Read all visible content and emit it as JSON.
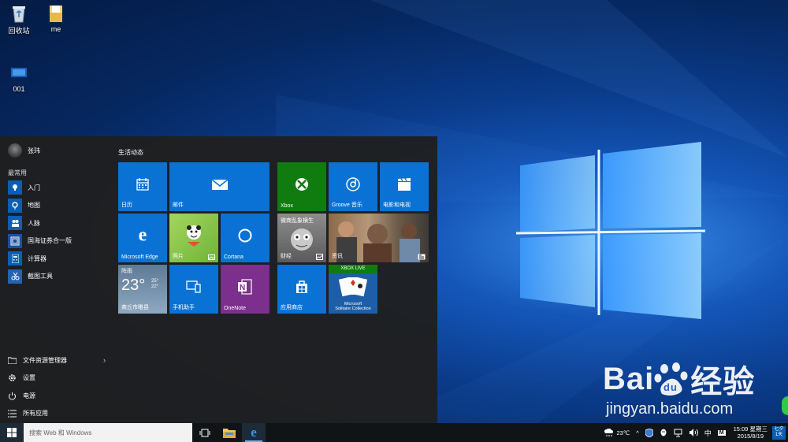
{
  "desktop": {
    "icons": [
      {
        "label": "回收站"
      },
      {
        "label": "me"
      },
      {
        "label": "001"
      }
    ]
  },
  "start_menu": {
    "user_name": "张玮",
    "most_used_label": "最常用",
    "apps": [
      {
        "label": "入门",
        "icon": "lightbulb-icon"
      },
      {
        "label": "地图",
        "icon": "map-icon"
      },
      {
        "label": "人脉",
        "icon": "people-icon"
      },
      {
        "label": "国海证券合一版",
        "icon": "app-icon"
      },
      {
        "label": "计算器",
        "icon": "calculator-icon"
      },
      {
        "label": "截图工具",
        "icon": "scissors-icon"
      }
    ],
    "bottom": [
      {
        "label": "文件资源管理器",
        "icon": "folder-icon",
        "has_arrow": true
      },
      {
        "label": "设置",
        "icon": "gear-icon"
      },
      {
        "label": "电源",
        "icon": "power-icon"
      },
      {
        "label": "所有应用",
        "icon": "list-icon"
      }
    ],
    "group_label": "生活动态",
    "tiles": {
      "calendar": "日历",
      "mail": "邮件",
      "edge": "Microsoft Edge",
      "photos": "照片",
      "cortana": "Cortana",
      "weather_city": "阵雨",
      "weather_temp": "23°",
      "weather_range": "25°\n22°",
      "weather_location": "商丘市睢县",
      "phone": "手机助手",
      "onenote": "OneNote",
      "xbox": "Xbox",
      "groove": "Groove 音乐",
      "movies": "电影和电视",
      "finance": "财经",
      "finance_headline": "微商乱象横生",
      "news": "资讯",
      "store": "应用商店",
      "xbox_live": "XBOX LIVE",
      "solitaire": "Microsoft\nSolitaire Collection"
    }
  },
  "taskbar": {
    "search_placeholder": "搜索 Web 和 Windows",
    "weather": "23℃",
    "ime": "中",
    "ime_m": "M",
    "time": "15:09 星期三",
    "date": "2015/8/19",
    "notif_top": "七夕",
    "notif_bottom": "1天"
  },
  "watermark": {
    "brand": "Bai",
    "brand_cn": "经验",
    "brand_du": "du",
    "url": "jingyan.baidu.com"
  }
}
